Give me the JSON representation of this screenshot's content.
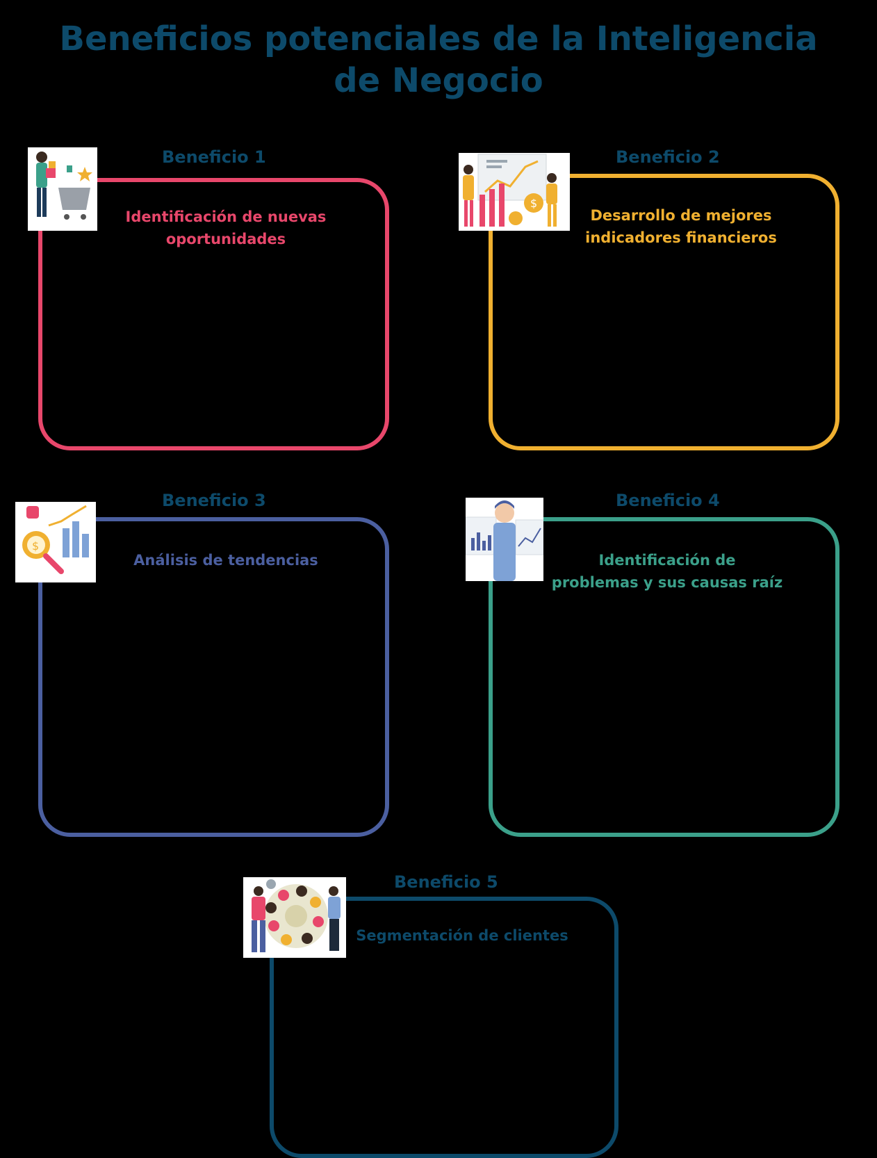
{
  "page": {
    "title_line1": "Beneficios potenciales de la Inteligencia",
    "title_line2": "de Negocio"
  },
  "benefits": [
    {
      "heading": "Beneficio 1",
      "subtitle_line1": "Identificación de nuevas",
      "subtitle_line2": "oportunidades",
      "color": "#e8476b",
      "icon": "shopping-cart-person-icon"
    },
    {
      "heading": "Beneficio 2",
      "subtitle_line1": "Desarrollo de mejores",
      "subtitle_line2": "indicadores financieros",
      "color": "#f0b030",
      "icon": "financial-growth-chart-icon"
    },
    {
      "heading": "Beneficio 3",
      "subtitle_line1": "Análisis de tendencias",
      "color": "#4b5fa0",
      "icon": "magnifier-trend-chart-icon"
    },
    {
      "heading": "Beneficio 4",
      "subtitle_line1": "Identificación de",
      "subtitle_line2": "problemas y sus causas raíz",
      "color": "#3ba08a",
      "icon": "analyst-dashboard-icon"
    },
    {
      "heading": "Beneficio 5",
      "subtitle_line1": "Segmentación de clientes",
      "color": "#0d4a6a",
      "icon": "customer-segments-wheel-icon"
    }
  ]
}
